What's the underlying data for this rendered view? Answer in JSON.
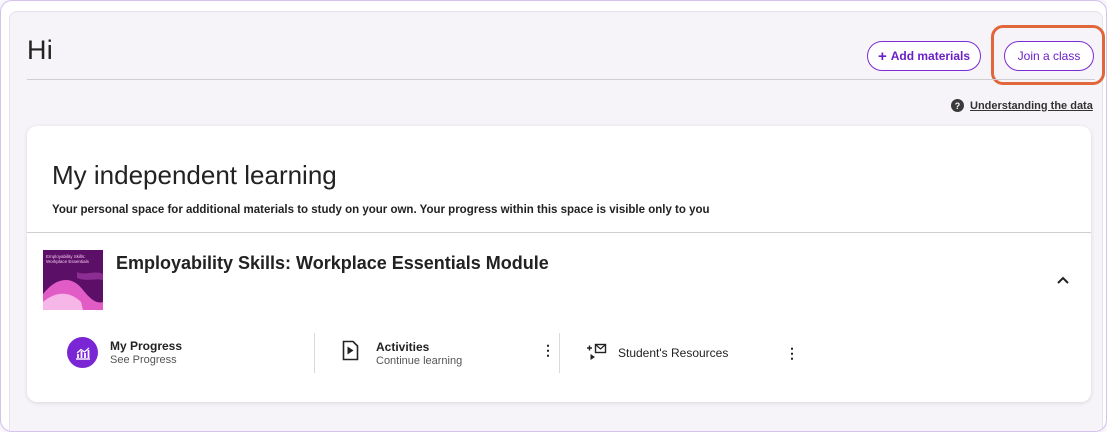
{
  "header": {
    "greeting": "Hi",
    "add_materials_label": "Add materials",
    "add_materials_symbol": "+",
    "join_class_label": "Join a class",
    "understanding_link": "Understanding the data",
    "help_symbol": "?"
  },
  "independent_learning": {
    "title": "My independent learning",
    "subtitle": "Your personal space for additional materials to study on your own. Your progress within this space is visible only to you",
    "module": {
      "thumbnail_text": "Employability Skills: Workplace Essentials",
      "title": "Employability Skills: Workplace Essentials Module",
      "expanded_icon": "chevron-up-icon",
      "my_progress": {
        "label": "My Progress",
        "sublabel": "See Progress",
        "icon": "chart-icon"
      },
      "activities": {
        "label": "Activities",
        "sublabel": "Continue learning",
        "icon": "play-document-icon"
      },
      "resources": {
        "label": "Student's Resources",
        "icon": "resources-icon"
      }
    }
  },
  "colors": {
    "accent": "#7b26d4",
    "highlight": "#e0673c",
    "thumbnail_bg": "#5b0f66"
  }
}
